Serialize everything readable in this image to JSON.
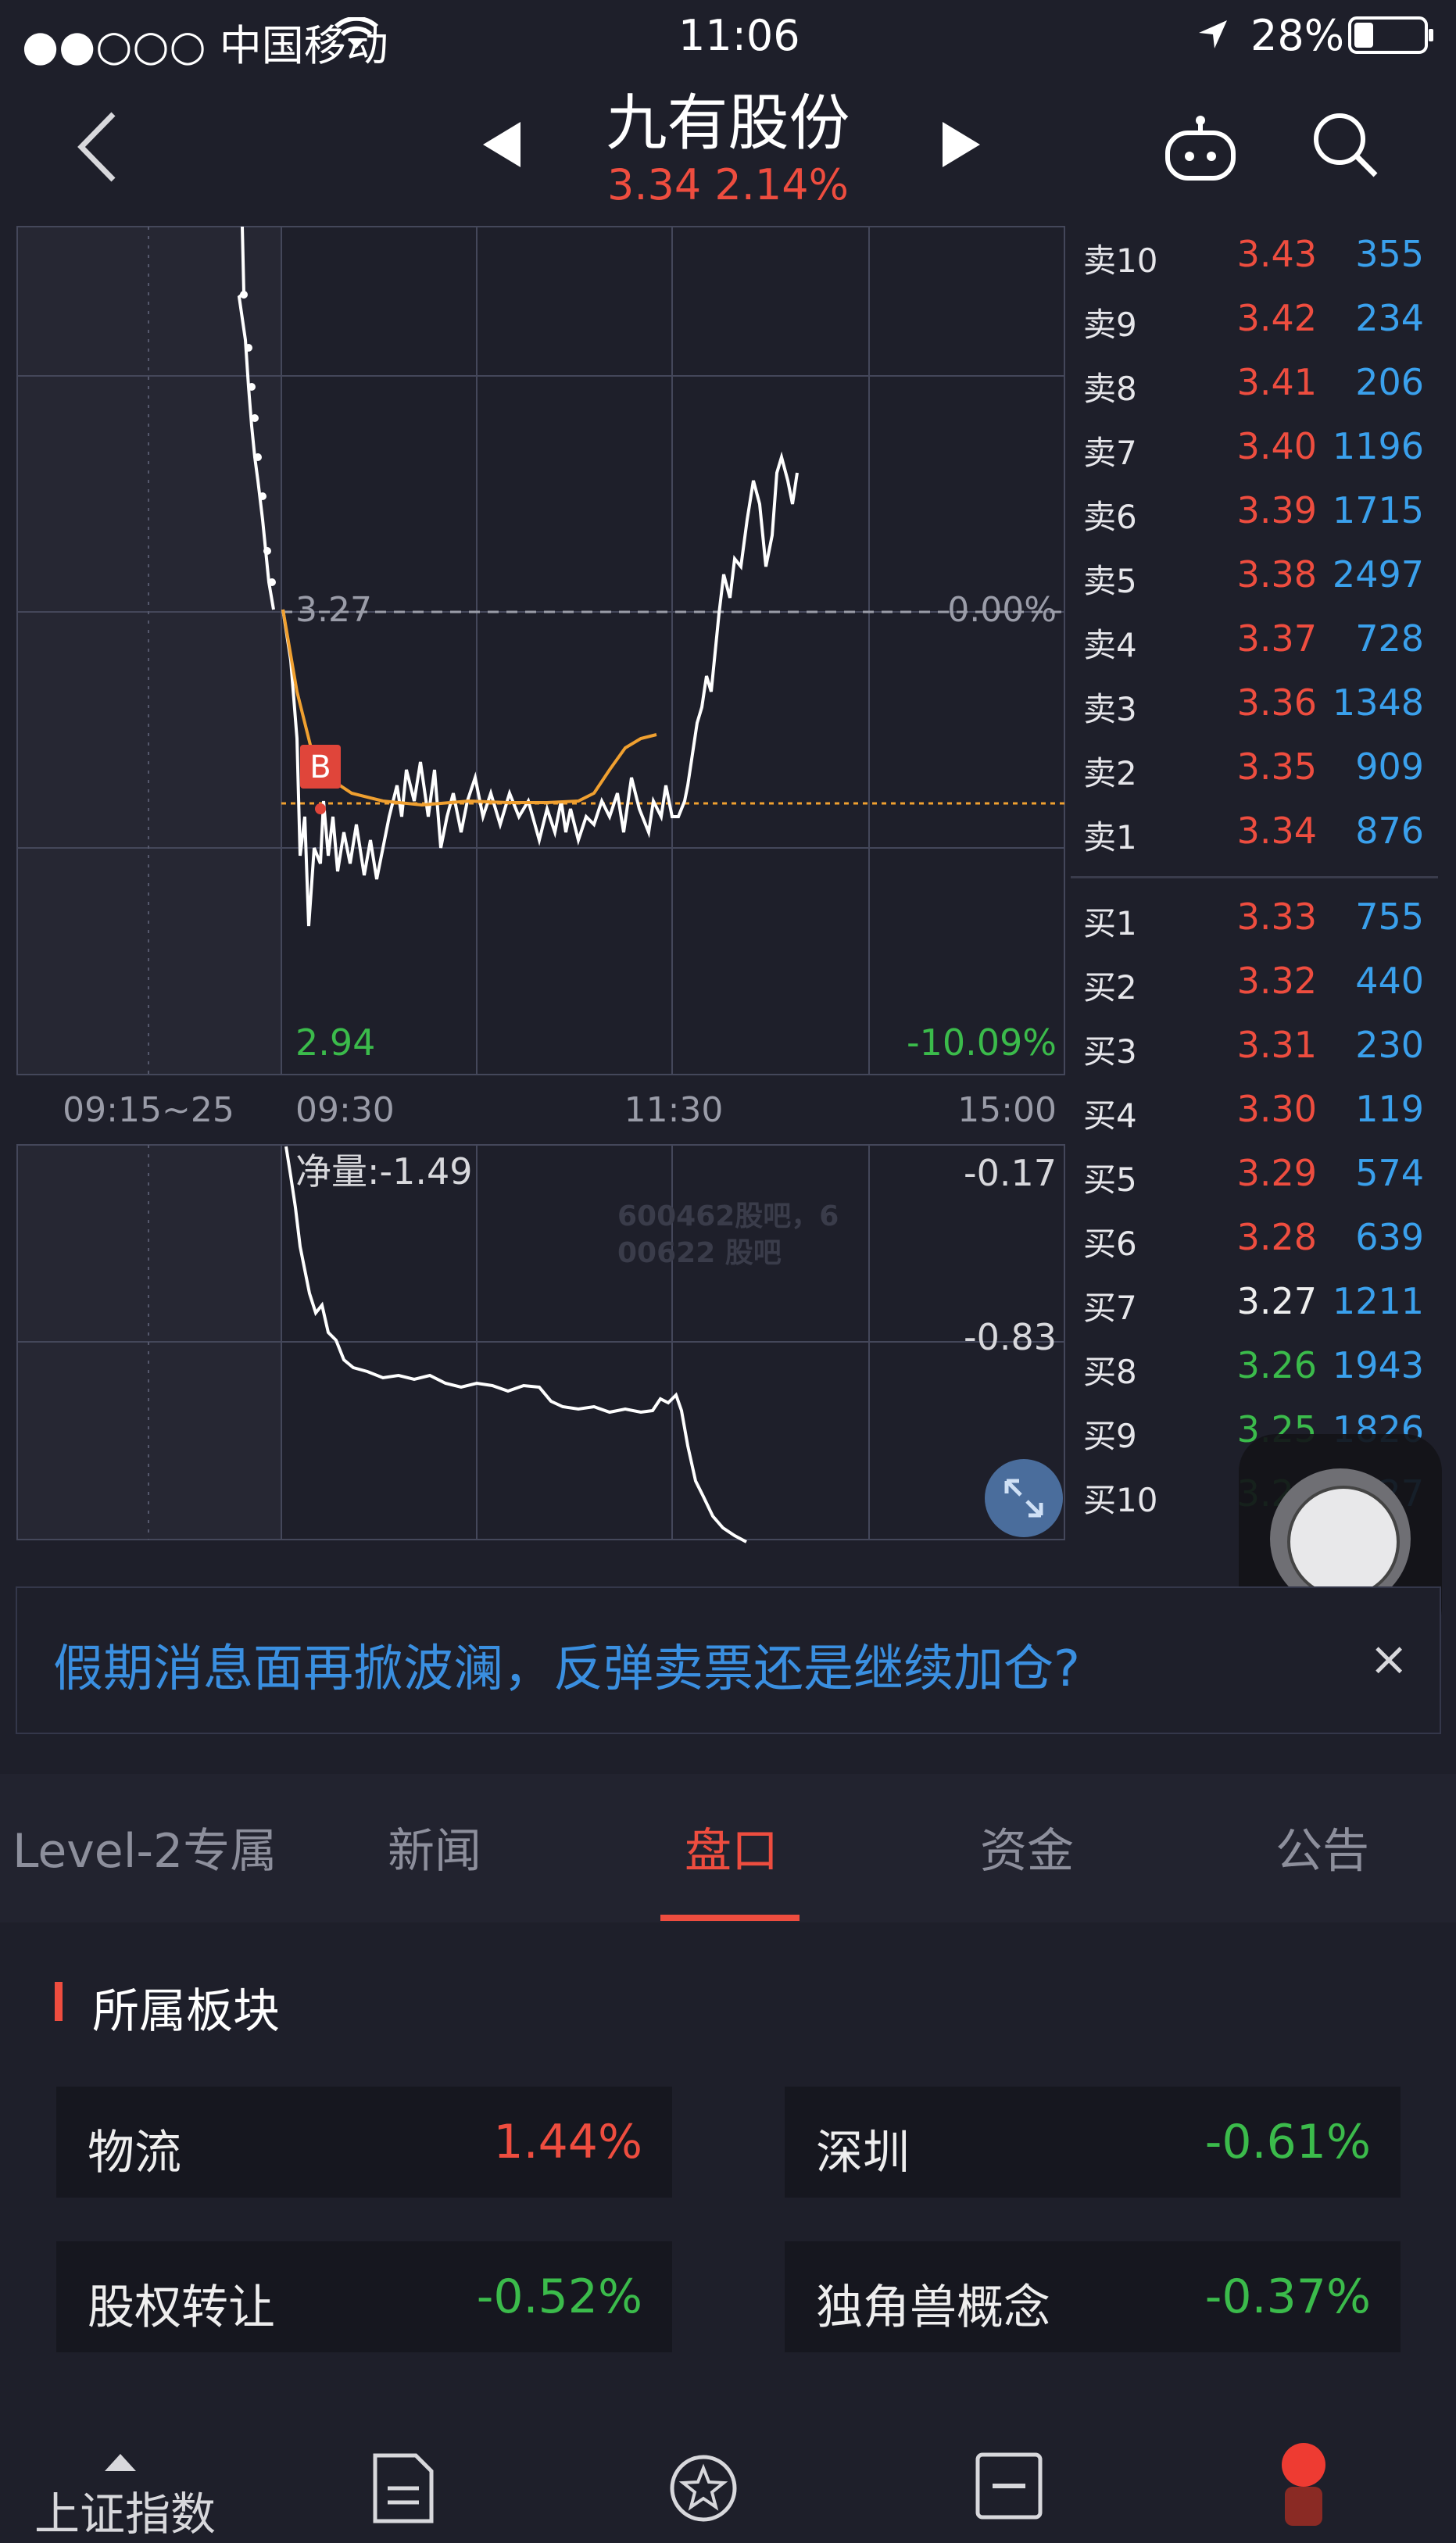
{
  "status_bar": {
    "carrier": "●●○○○ 中国移动",
    "time": "11:06",
    "battery": "28%"
  },
  "header": {
    "title": "九有股份",
    "price_line": "3.34 2.14%"
  },
  "chart": {
    "prev_close_label": "3.27",
    "zero_pct_label": "0.00%",
    "low_label": "2.94",
    "low_pct_label": "-10.09%",
    "time_labels": [
      "09:15~25",
      "09:30",
      "11:30",
      "15:00"
    ],
    "net_label": "净量:-1.49",
    "net_top": "-0.17",
    "net_mid": "-0.83",
    "buy_marker": "B",
    "watermark": "600462股吧，600622 股吧"
  },
  "order_book": {
    "asks": [
      {
        "label": "卖10",
        "price": "3.43",
        "vol": "355"
      },
      {
        "label": "卖9",
        "price": "3.42",
        "vol": "234"
      },
      {
        "label": "卖8",
        "price": "3.41",
        "vol": "206"
      },
      {
        "label": "卖7",
        "price": "3.40",
        "vol": "1196"
      },
      {
        "label": "卖6",
        "price": "3.39",
        "vol": "1715"
      },
      {
        "label": "卖5",
        "price": "3.38",
        "vol": "2497"
      },
      {
        "label": "卖4",
        "price": "3.37",
        "vol": "728"
      },
      {
        "label": "卖3",
        "price": "3.36",
        "vol": "1348"
      },
      {
        "label": "卖2",
        "price": "3.35",
        "vol": "909"
      },
      {
        "label": "卖1",
        "price": "3.34",
        "vol": "876"
      }
    ],
    "bids": [
      {
        "label": "买1",
        "price": "3.33",
        "vol": "755",
        "tone": "red"
      },
      {
        "label": "买2",
        "price": "3.32",
        "vol": "440",
        "tone": "red"
      },
      {
        "label": "买3",
        "price": "3.31",
        "vol": "230",
        "tone": "red"
      },
      {
        "label": "买4",
        "price": "3.30",
        "vol": "119",
        "tone": "red"
      },
      {
        "label": "买5",
        "price": "3.29",
        "vol": "574",
        "tone": "red"
      },
      {
        "label": "买6",
        "price": "3.28",
        "vol": "639",
        "tone": "red"
      },
      {
        "label": "买7",
        "price": "3.27",
        "vol": "1211",
        "tone": "white"
      },
      {
        "label": "买8",
        "price": "3.26",
        "vol": "1943",
        "tone": "green"
      },
      {
        "label": "买9",
        "price": "3.25",
        "vol": "1826",
        "tone": "green"
      },
      {
        "label": "买10",
        "price": "3.24",
        "vol": "327",
        "tone": "green"
      }
    ]
  },
  "banner": {
    "text": "假期消息面再掀波澜，反弹卖票还是继续加仓?",
    "close": "×"
  },
  "tabs": [
    "Level-2专属",
    "新闻",
    "盘口",
    "资金",
    "公告"
  ],
  "active_tab": "盘口",
  "sectors": {
    "title": "所属板块",
    "items": [
      {
        "name": "物流",
        "pct": "1.44%",
        "tone": "red"
      },
      {
        "name": "深圳",
        "pct": "-0.61%",
        "tone": "green"
      },
      {
        "name": "股权转让",
        "pct": "-0.52%",
        "tone": "green"
      },
      {
        "name": "独角兽概念",
        "pct": "-0.37%",
        "tone": "green"
      }
    ]
  },
  "bottom_nav": {
    "first_label": "上证指数"
  },
  "colors": {
    "up": "#ee4d3f",
    "down": "#3bbb4b",
    "vol": "#3aa0ec",
    "avg_line": "#f0a030"
  }
}
